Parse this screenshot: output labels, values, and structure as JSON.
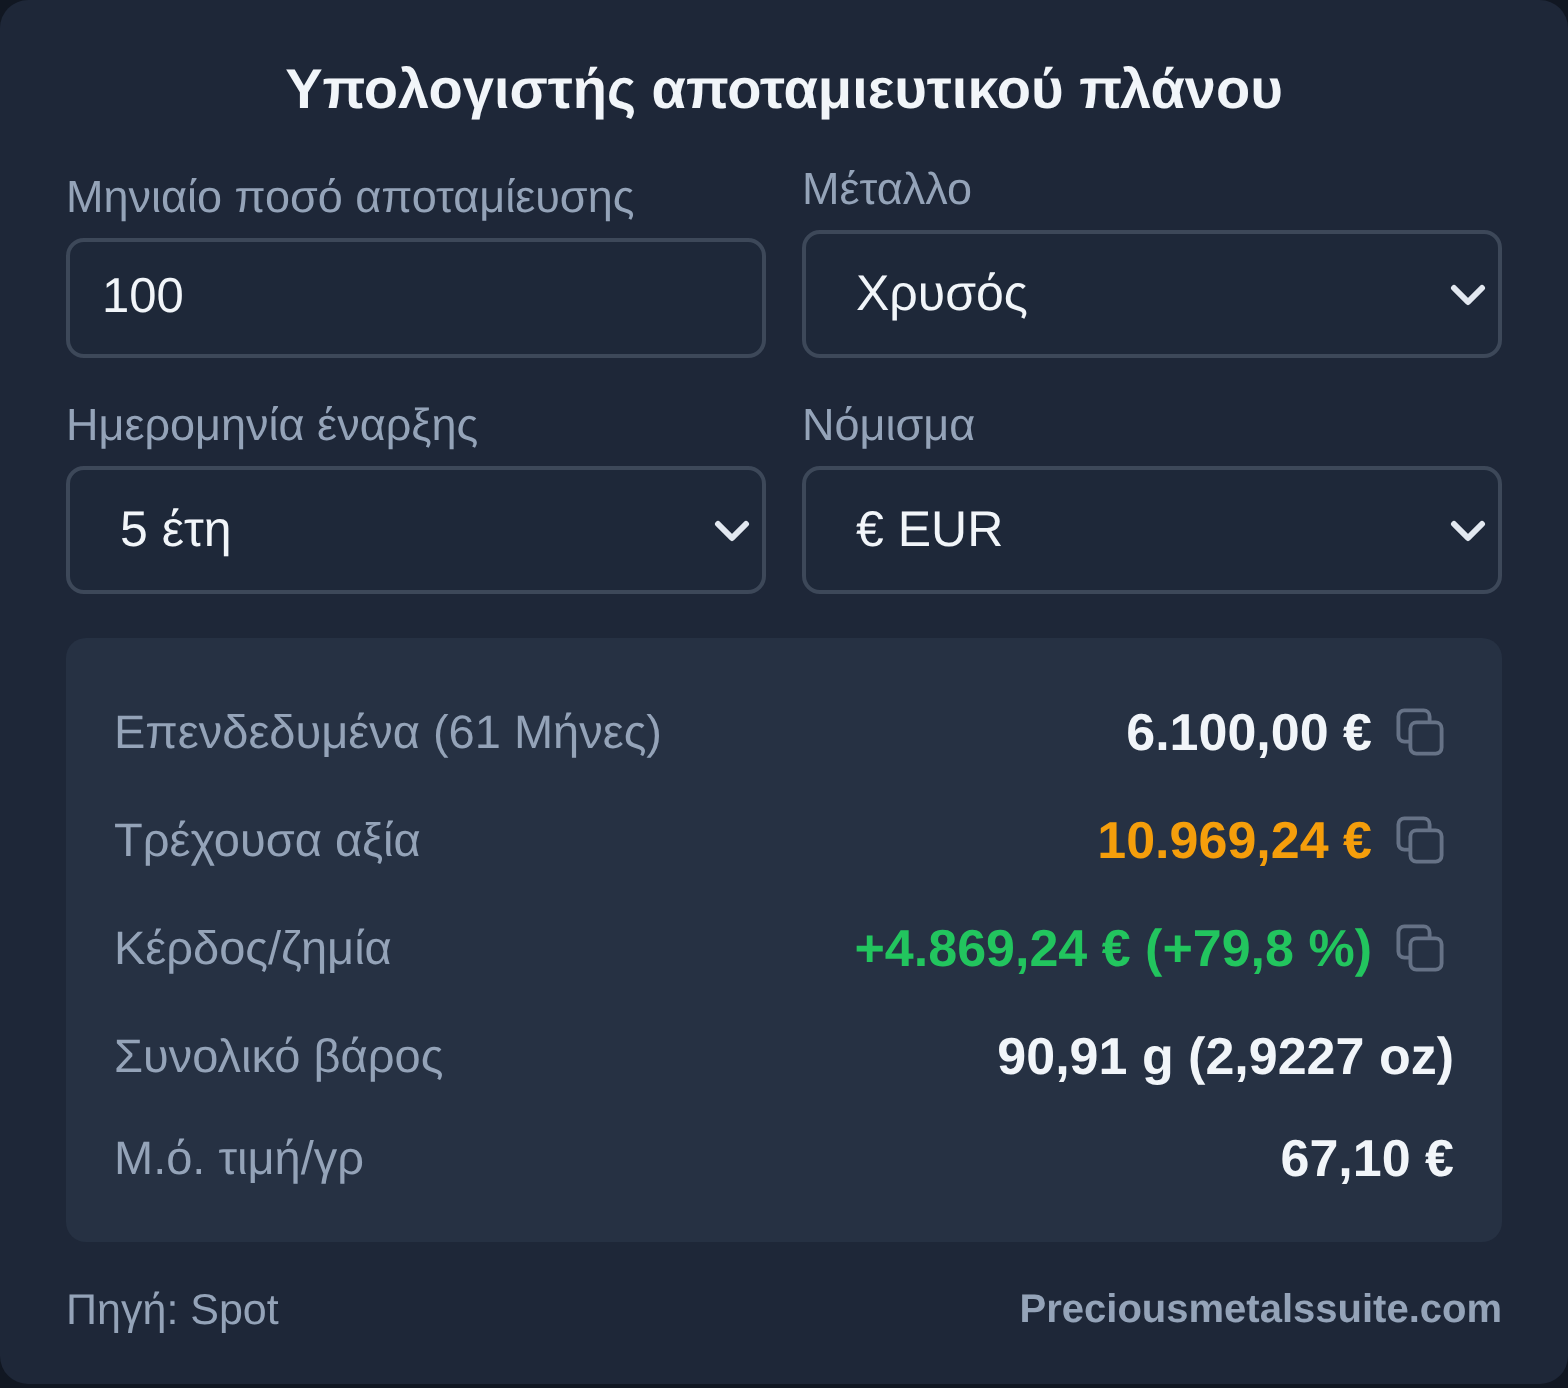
{
  "title": "Υπολογιστής αποταμιευτικού πλάνου",
  "fields": [
    {
      "kind": "input",
      "label": "Μηνιαίο ποσό αποταμίευσης",
      "value": "100"
    },
    {
      "kind": "select",
      "label": "Μέταλλο",
      "value": "Χρυσός"
    },
    {
      "kind": "select",
      "label": "Ημερομηνία έναρξης",
      "value": "5 έτη"
    },
    {
      "kind": "select",
      "label": "Νόμισμα",
      "value": "€ EUR"
    }
  ],
  "results": [
    {
      "label": "Επενδεδυμένα (61 Μήνες)",
      "value": "6.100,00 €",
      "color": "#f1f5f9",
      "copyable": true
    },
    {
      "label": "Τρέχουσα αξία",
      "value": "10.969,24 €",
      "color": "#f59e0b",
      "copyable": true
    },
    {
      "label": "Κέρδος/ζημία",
      "value": "+4.869,24 € (+79,8 %)",
      "color": "#22c55e",
      "copyable": true
    },
    {
      "label": "Συνολικό βάρος",
      "value": "90,91 g (2,9227 oz)",
      "color": "#f1f5f9",
      "copyable": false
    },
    {
      "label": "Μ.ό. τιμή/γρ",
      "value": "67,10 €",
      "color": "#f1f5f9",
      "copyable": false
    }
  ],
  "footer": {
    "source": "Πηγή: Spot",
    "brand": "Preciousmetalssuite.com"
  }
}
